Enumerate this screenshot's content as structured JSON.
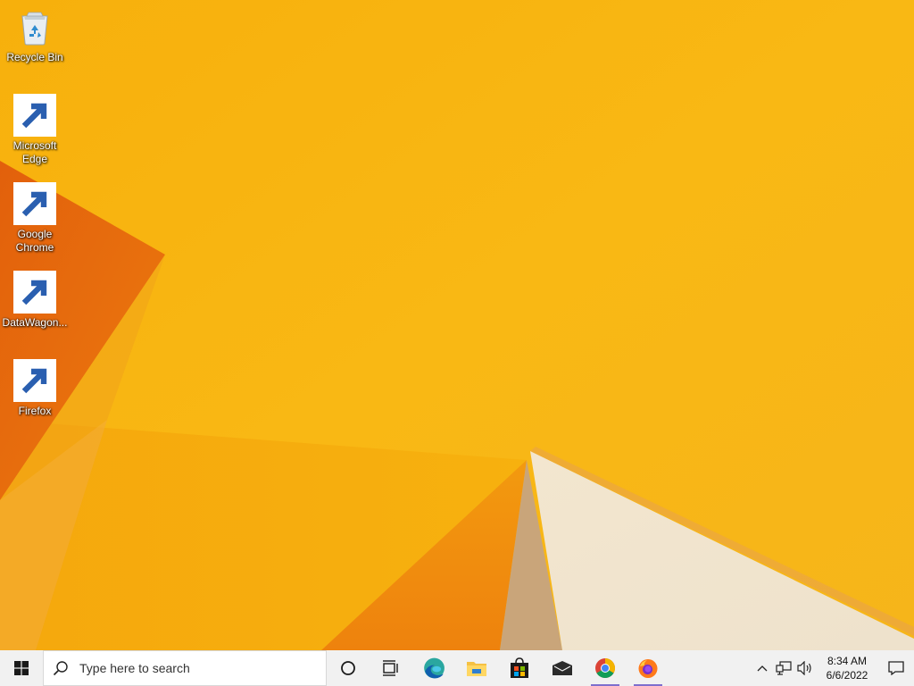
{
  "desktop": {
    "icons": [
      {
        "label": "Recycle Bin"
      },
      {
        "label": "Microsoft Edge"
      },
      {
        "label": "Google Chrome"
      },
      {
        "label": "DataWagon..."
      },
      {
        "label": "Firefox"
      }
    ]
  },
  "taskbar": {
    "search_placeholder": "Type here to search",
    "apps": [
      "cortana-icon",
      "task-view-icon",
      "edge-icon",
      "file-explorer-icon",
      "store-icon",
      "mail-icon",
      "chrome-icon",
      "firefox-icon"
    ],
    "clock": {
      "time": "8:34 AM",
      "date": "6/6/2022"
    }
  },
  "colors": {
    "wallpaper_base": "#f9b712",
    "taskbar_bg": "#f1f1f1",
    "running_indicator": "#7e6fce"
  }
}
